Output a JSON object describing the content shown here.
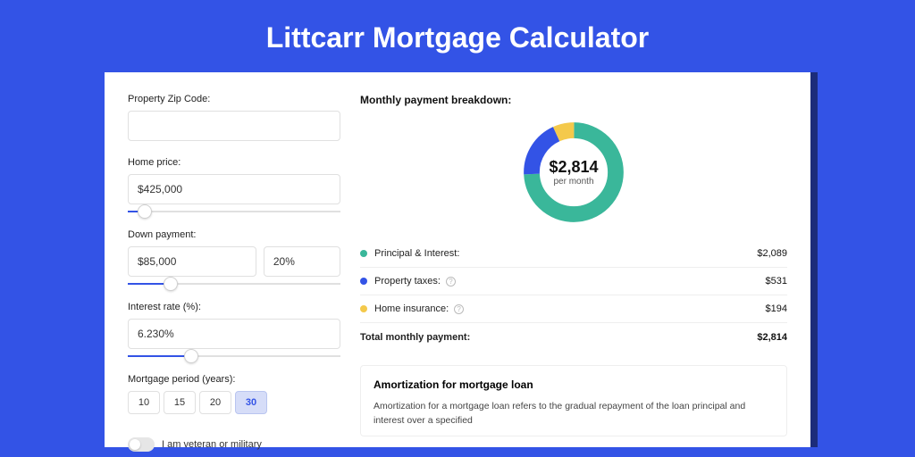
{
  "title": "Littcarr Mortgage Calculator",
  "form": {
    "zip_label": "Property Zip Code:",
    "zip_value": "",
    "home_price_label": "Home price:",
    "home_price_value": "$425,000",
    "home_price_slider_pct": 8,
    "down_payment_label": "Down payment:",
    "down_payment_value": "$85,000",
    "down_payment_pct": "20%",
    "down_payment_slider_pct": 20,
    "rate_label": "Interest rate (%):",
    "rate_value": "6.230%",
    "rate_slider_pct": 30,
    "period_label": "Mortgage period (years):",
    "period_options": [
      "10",
      "15",
      "20",
      "30"
    ],
    "period_selected": "30",
    "vet_label": "I am veteran or military"
  },
  "breakdown": {
    "title": "Monthly payment breakdown:",
    "center_amount": "$2,814",
    "center_sub": "per month",
    "rows": [
      {
        "color": "#3ab79a",
        "label": "Principal & Interest:",
        "value": "$2,089",
        "info": false
      },
      {
        "color": "#3353e6",
        "label": "Property taxes:",
        "value": "$531",
        "info": true
      },
      {
        "color": "#f4c94b",
        "label": "Home insurance:",
        "value": "$194",
        "info": true
      }
    ],
    "total_label": "Total monthly payment:",
    "total_value": "$2,814"
  },
  "chart_data": {
    "type": "pie",
    "title": "Monthly payment breakdown",
    "series": [
      {
        "name": "Principal & Interest",
        "value": 2089,
        "color": "#3ab79a"
      },
      {
        "name": "Property taxes",
        "value": 531,
        "color": "#3353e6"
      },
      {
        "name": "Home insurance",
        "value": 194,
        "color": "#f4c94b"
      }
    ],
    "total": 2814
  },
  "amortization": {
    "title": "Amortization for mortgage loan",
    "text": "Amortization for a mortgage loan refers to the gradual repayment of the loan principal and interest over a specified"
  }
}
